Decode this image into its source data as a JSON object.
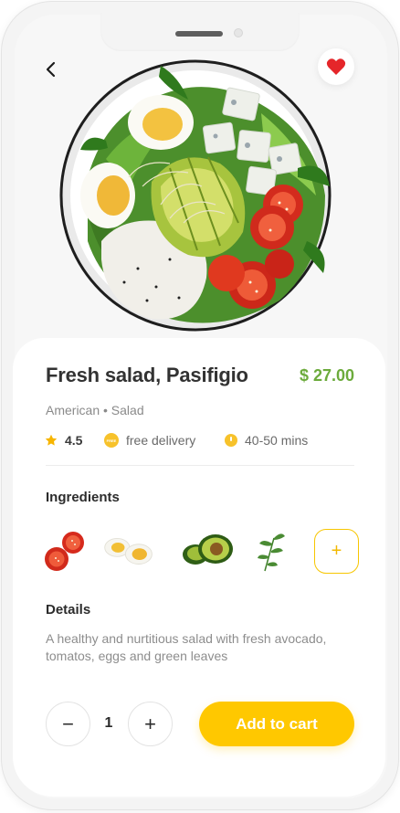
{
  "product": {
    "title": "Fresh salad, Pasifigio",
    "price": "$ 27.00",
    "subtitle": "American • Salad"
  },
  "meta": {
    "rating": "4.5",
    "delivery": "free delivery",
    "delivery_badge": "FREE",
    "time": "40-50 mins"
  },
  "ingredients": {
    "title": "Ingredients",
    "items": [
      "tomato",
      "egg",
      "avocado",
      "greens"
    ],
    "add_label": "+"
  },
  "details": {
    "title": "Details",
    "text": "A healthy and nurtitious salad with fresh avocado, tomatos, eggs and green leaves"
  },
  "cart": {
    "minus": "−",
    "plus": "+",
    "quantity": "1",
    "add_label": "Add to cart"
  },
  "colors": {
    "accent": "#ffc800",
    "price": "#6cab3c",
    "heart": "#e5262a"
  }
}
